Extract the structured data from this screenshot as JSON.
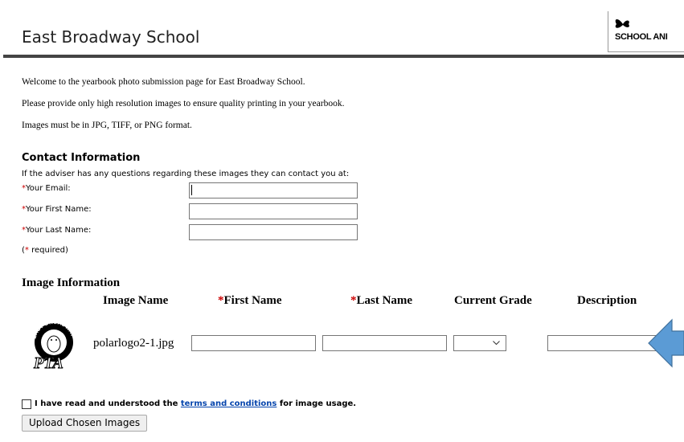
{
  "header": {
    "title": "East Broadway School",
    "logo_text": "SCHOOL ANI"
  },
  "intro": {
    "line1": "Welcome to the yearbook photo submission page for East Broadway School.",
    "line2": "Please provide only high resolution images to ensure quality printing in your yearbook.",
    "line3": "Images must be in JPG, TIFF, or PNG format."
  },
  "contact": {
    "heading": "Contact Information",
    "subtext": "If the adviser has any questions regarding these images they can contact you at:",
    "required_mark": "*",
    "email_label": "Your Email:",
    "first_name_label": "Your First Name:",
    "last_name_label": "Your Last Name:",
    "email_value": "",
    "first_name_value": "",
    "last_name_value": "",
    "required_note_open": "(",
    "required_note_close": " required)"
  },
  "image_info": {
    "heading": "Image Information",
    "columns": {
      "image_name": "Image Name",
      "first_name": "First Name",
      "last_name": "Last Name",
      "current_grade": "Current Grade",
      "description": "Description"
    },
    "rows": [
      {
        "filename": "polarlogo2-1.jpg",
        "first_name": "",
        "last_name": "",
        "grade": "",
        "description": ""
      }
    ],
    "thumbnail_text": {
      "top": "EAST BROADWAY",
      "bottom": "PTA"
    }
  },
  "terms": {
    "prefix": "I have read and understood the ",
    "link": "terms and conditions",
    "suffix": " for image usage.",
    "checked": false
  },
  "upload_button": "Upload Chosen Images",
  "colors": {
    "required": "#cc0000",
    "link": "#0645ad",
    "arrow": "#5b9bd5",
    "arrow_border": "#41719c",
    "header_rule": "#444444"
  }
}
